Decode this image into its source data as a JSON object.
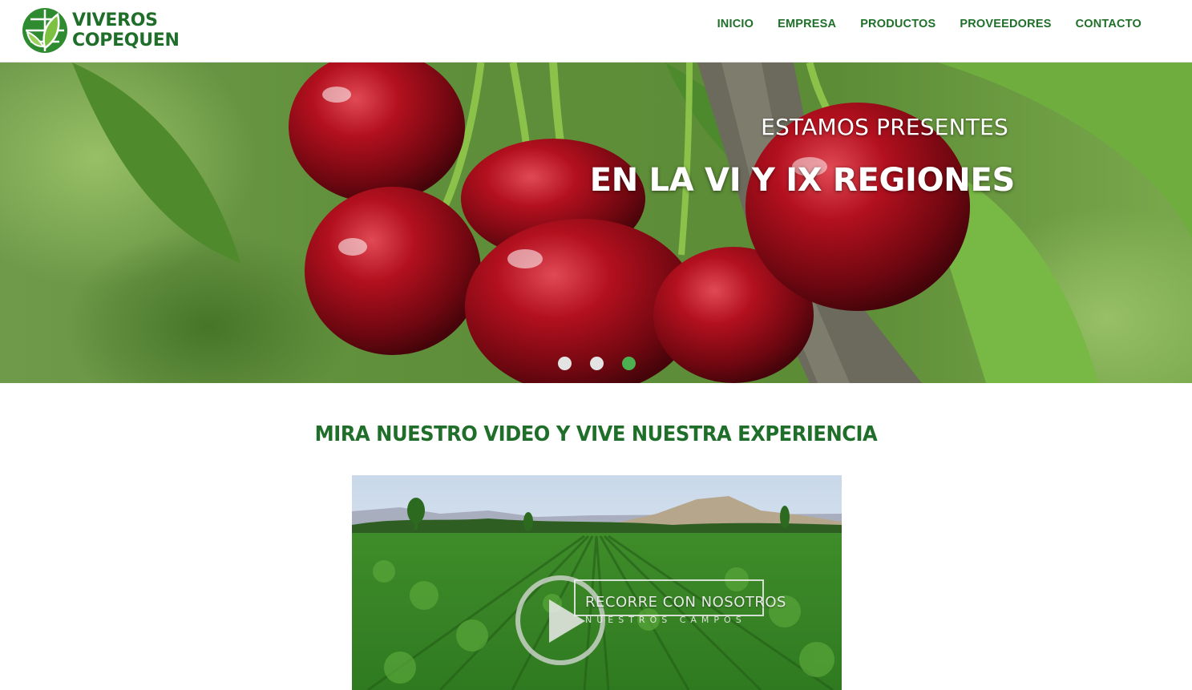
{
  "brand": {
    "line1": "VIVEROS",
    "line2": "COPEQUEN",
    "logo_icon": "leaf-globe-logo"
  },
  "nav": {
    "items": [
      {
        "label": "INICIO"
      },
      {
        "label": "EMPRESA"
      },
      {
        "label": "PRODUCTOS"
      },
      {
        "label": "PROVEEDORES"
      },
      {
        "label": "CONTACTO"
      }
    ]
  },
  "hero": {
    "subtitle": "ESTAMOS PRESENTES",
    "title": "EN LA VI Y IX REGIONES",
    "image": "cherries-on-branch",
    "slides": 3,
    "active_slide": 3
  },
  "video_section": {
    "heading": "MIRA NUESTRO VIDEO Y VIVE NUESTRA EXPERIENCIA",
    "thumbnail": "nursery-fields-with-mountain",
    "overlay_title": "RECORRE CON NOSOTROS",
    "overlay_subtitle": "NUESTROS CAMPOS",
    "play_icon": "play-icon"
  },
  "colors": {
    "brand_green": "#1f6f2a",
    "active_dot": "#4caf50",
    "inactive_dot": "#e3e3e3"
  }
}
